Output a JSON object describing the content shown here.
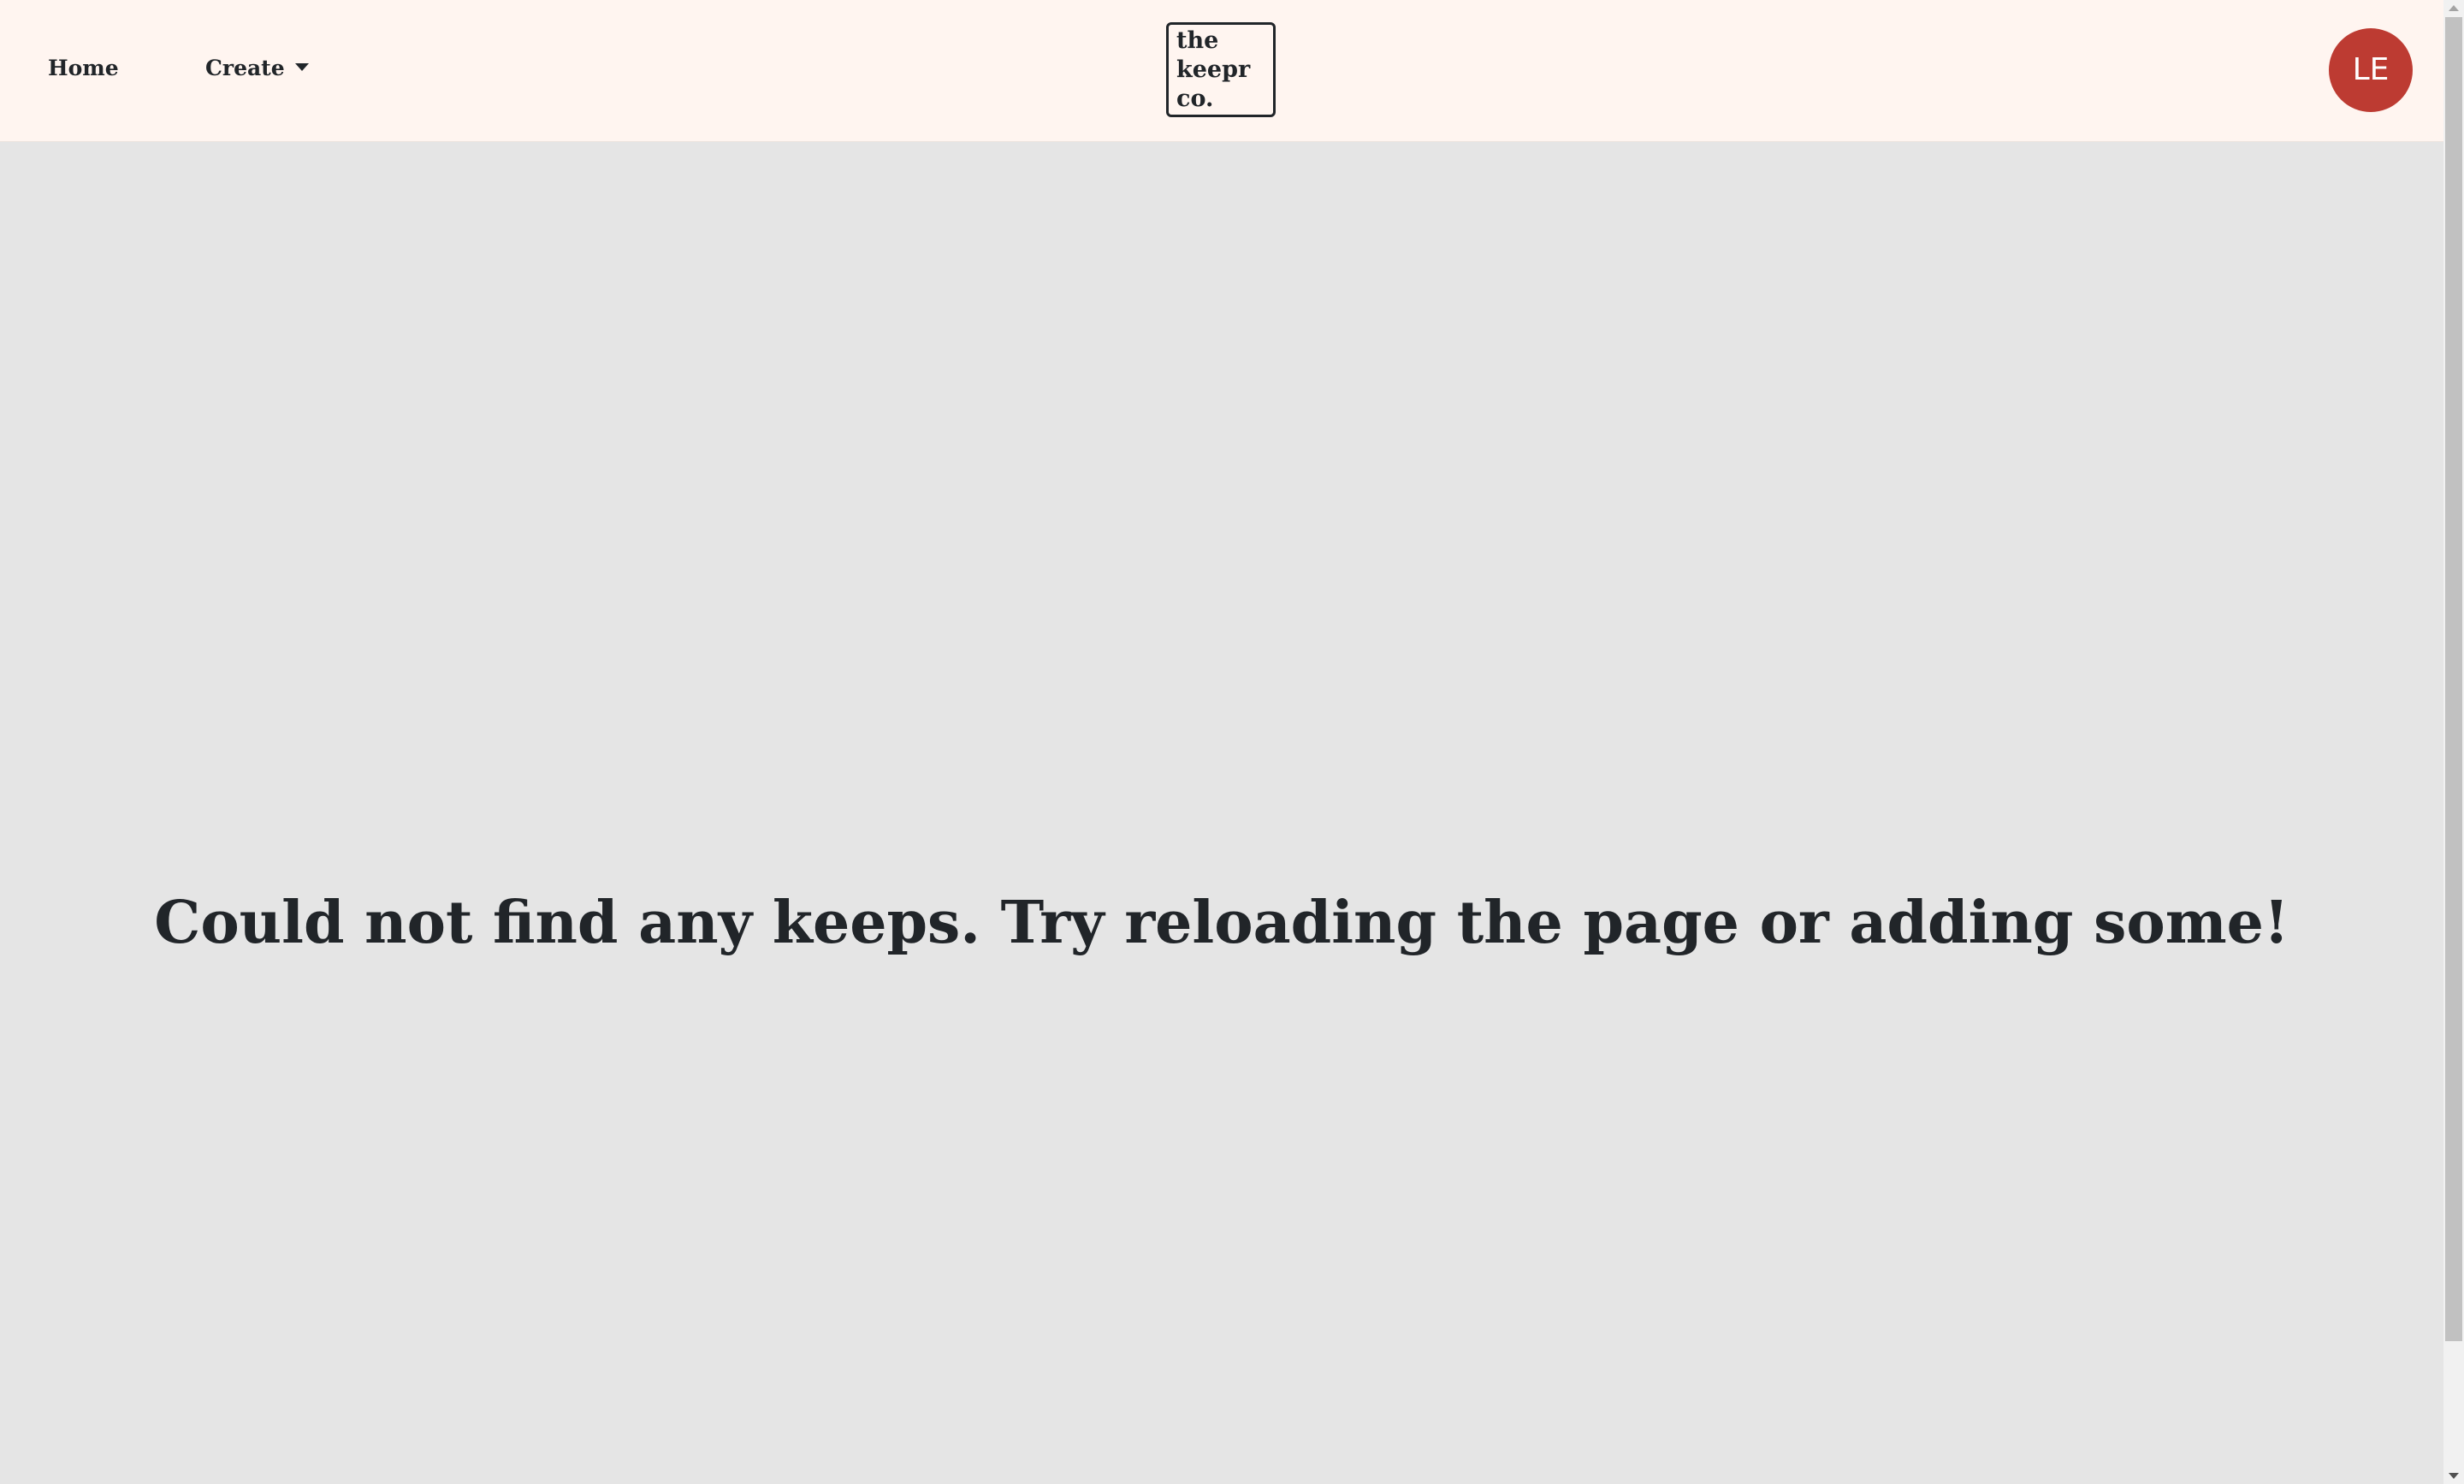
{
  "navbar": {
    "home_label": "Home",
    "create_label": "Create",
    "logo_lines": [
      "the",
      "keepr",
      "co."
    ],
    "avatar_initials": "LE"
  },
  "main": {
    "empty_message": "Could not find any keeps. Try reloading the page or adding some!"
  },
  "colors": {
    "navbar_bg": "#fff5f0",
    "page_bg": "#e5e5e5",
    "avatar_bg": "#bd3b32",
    "text": "#212529"
  },
  "icons": {
    "create_dropdown": "caret-down-icon"
  }
}
